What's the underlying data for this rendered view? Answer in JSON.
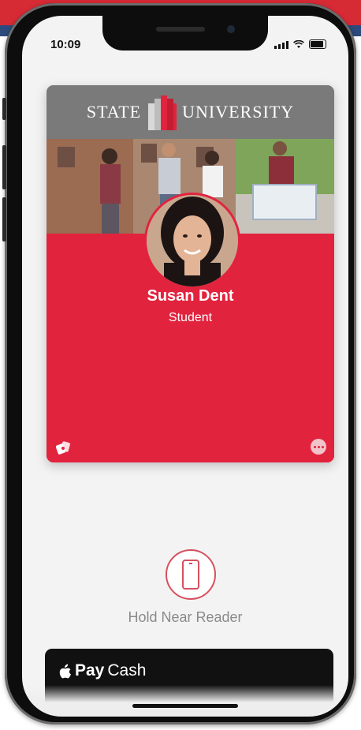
{
  "status_bar": {
    "time": "10:09"
  },
  "card": {
    "org_left": "STATE",
    "org_right": "UNIVERSITY",
    "holder_name": "Susan Dent",
    "holder_role": "Student"
  },
  "reader": {
    "label": "Hold Near Reader"
  },
  "apple_pay_cash": {
    "pay": "Pay",
    "cash": "Cash"
  },
  "colors": {
    "card_red": "#e2233e",
    "header_gray": "#7a7a7a",
    "reader_accent": "#d6505e"
  },
  "icons": [
    "signal-icon",
    "wifi-icon",
    "battery-icon",
    "university-logo-icon",
    "nfc-card-icon",
    "more-icon",
    "reader-phone-icon",
    "apple-logo-icon"
  ]
}
